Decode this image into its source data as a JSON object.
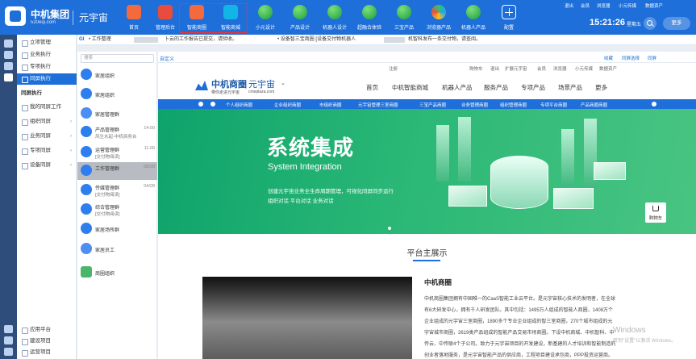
{
  "brand": {
    "name": "中机集团",
    "sub": "520eqi.com",
    "cn": "元宇宙"
  },
  "topnav": [
    {
      "label": "首页",
      "icon": "home-icon"
    },
    {
      "label": "管理后台",
      "icon": "admin-icon"
    },
    {
      "label": "智能商圈",
      "icon": "smart-circle-icon"
    },
    {
      "label": "智能商城",
      "icon": "mall-cart-icon"
    },
    {
      "label": "小元设计",
      "icon": "design-globe-icon"
    },
    {
      "label": "产品设计",
      "icon": "product-globe-icon"
    },
    {
      "label": "机器人设计",
      "icon": "robot-globe-icon"
    },
    {
      "label": "超融合体验",
      "icon": "fusion-globe-icon"
    },
    {
      "label": "三宝产品",
      "icon": "sanbao-globe-icon"
    },
    {
      "label": "浏览器产品",
      "icon": "browser-swirl-icon"
    },
    {
      "label": "机器人产品",
      "icon": "robot-product-globe-icon"
    },
    {
      "label": "配置",
      "icon": "plus-icon"
    }
  ],
  "toplinks": [
    "退出",
    "会员",
    "浏览器",
    "小元传媒",
    "数据资产"
  ],
  "clock": "15:21:26",
  "weekday": "星期五",
  "more": "更多",
  "menu": {
    "items": [
      "立项管理",
      "业务执行",
      "专项执行",
      "同屏执行"
    ],
    "section": "同屏执行",
    "sub_items": [
      "我的同屏工作",
      "组织同屏",
      "业务同屏",
      "专项同屏",
      "设备同屏"
    ],
    "bottom": [
      "应用平台",
      "建设项目",
      "运营项目"
    ]
  },
  "notice": {
    "tag": "GI",
    "text1": "• 工作整理",
    "text2": "卜云的工作报告已提交，请验收。",
    "text3": "• 设备智三宝商圈 [设备交付物机器人",
    "text4": "机智科发布一条交付物，请查阅。"
  },
  "contacts": {
    "search_placeholder": "搜索",
    "rows": [
      {
        "name": "家居组织",
        "sub": "",
        "time": ""
      },
      {
        "name": "家居组织",
        "sub": "",
        "time": ""
      },
      {
        "name": "家居管理群",
        "sub": "",
        "time": ""
      },
      {
        "name": "产品管理群",
        "sub": "风生水起-中机商务台",
        "time": "14:00"
      },
      {
        "name": "运营管理群",
        "sub": "[交付物阅读]",
        "time": "11:00"
      },
      {
        "name": "工作管理群",
        "sub": "",
        "time": "08/28"
      },
      {
        "name": "传媒管理群",
        "sub": "[交付物阅读]",
        "time": "04/28"
      },
      {
        "name": "综合管理群",
        "sub": "[交付物阅读]",
        "time": ""
      },
      {
        "name": "家居场所群",
        "sub": "",
        "time": ""
      },
      {
        "name": "家居员工",
        "sub": "",
        "time": ""
      },
      {
        "name": "商圈组织",
        "sub": "",
        "time": ""
      }
    ]
  },
  "browser": {
    "address_label": "自定义",
    "actions": [
      "收藏",
      "同屏选择",
      "同屏"
    ]
  },
  "site": {
    "topline": [
      "注册",
      "购物车",
      "退出",
      "扩展元宇宙",
      "会员",
      "浏览器",
      "小元传媒",
      "数据资产"
    ],
    "logo_text": "中机商圈",
    "logo_sub": "带你走进元宇宙",
    "logo_cn": "元宇宙",
    "logo_url": "cmeplaza.com",
    "nav": [
      "首页",
      "中机智能商城",
      "机器人产品",
      "服务产品",
      "专项产品",
      "场景产品",
      "更多"
    ],
    "categories": [
      "个人组织商圈",
      "企业组织商圈",
      "市组织商圈",
      "元宇宙管理三室商圈",
      "三宝产品商圈",
      "业务管理商圈",
      "组织管理商圈",
      "专项平台商圈",
      "产品商圈商圈"
    ],
    "banner": {
      "title": "系统集成",
      "en": "System Integration",
      "line1": "创建元宇宙业务全生命周期管理，可视化同屏同步运行",
      "line2": "组织对话  平台对话  业务对话",
      "cart": "购物车"
    },
    "section_title": "平台主展示",
    "intro_title": "中机商圈",
    "intro_lines": [
      "中机商圈集团拥有中国唯一的CaaS智能工业云平台。是元宇宙核心技术的发明者，在全球",
      "有6大研发中心，拥有千人研发团队。其中包括：1495万人组成的智能人商圈，1408万个",
      "企业组成的元宇宙三室商圈，1890多个专业企业组成的智三室商圈，270个城市组成的元",
      "宇宙城市商圈，2619类产品组成的智能产品交易市场商圈。下设中机商城、中机智科、中",
      "传云、中传联4个子公司。致力于元宇宙项目的开发建设，新基建的人才培训和智能制造的",
      "创业者落地服务，是元宇宙智能产品的供应商，工程项目建设承包商，PPP投资运营商。"
    ]
  },
  "watermark": {
    "line1": "Windows",
    "line2": "转到\"设置\"以激活 Windows。"
  }
}
